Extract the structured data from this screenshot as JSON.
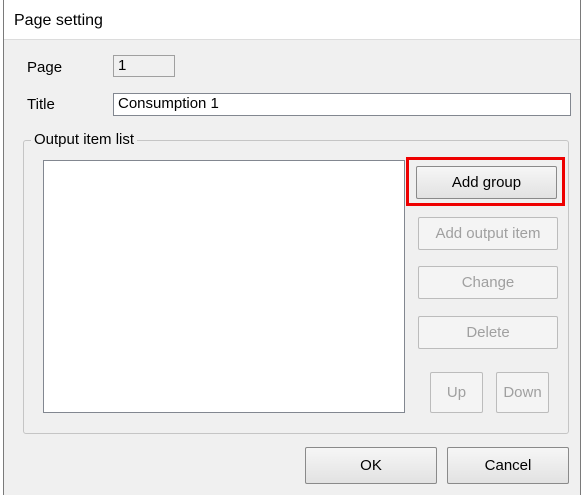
{
  "window": {
    "title": "Page setting"
  },
  "form": {
    "page_label": "Page",
    "page_value": "1",
    "title_label": "Title",
    "title_value": "Consumption 1"
  },
  "output_list": {
    "legend": "Output item list",
    "items": []
  },
  "buttons": {
    "add_group": "Add group",
    "add_output_item": "Add output item",
    "change": "Change",
    "delete": "Delete",
    "up": "Up",
    "down": "Down",
    "ok": "OK",
    "cancel": "Cancel"
  },
  "colors": {
    "highlight": "#ee0000",
    "dialog_bg": "#f0f0f0",
    "disabled_text": "#a0a0a0"
  }
}
